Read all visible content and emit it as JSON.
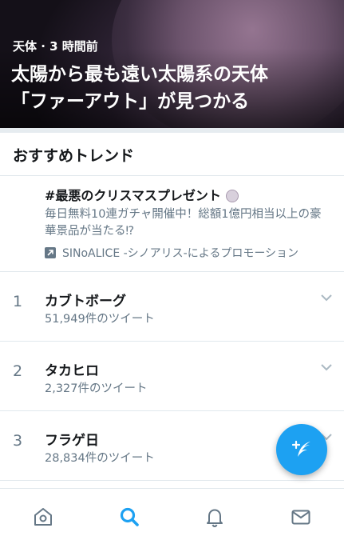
{
  "hero": {
    "meta": "天体 · 3 時間前",
    "title_lines": [
      "太陽から最も遠い太陽系の天体",
      "「ファーアウト」が見つかる"
    ]
  },
  "trends_section": {
    "header": "おすすめトレンド",
    "promoted": {
      "title": "#最悪のクリスマスプレゼント",
      "description": "毎日無料10連ガチャ開催中！総額1億円相当以上の豪華景品が当たる⁉",
      "promoted_by": "SINoALICE -シノアリス-によるプロモーション",
      "promoted_icon": "promoted-arrow-icon"
    },
    "items": [
      {
        "rank": "1",
        "name": "カブトボーグ",
        "count": "51,949件のツイート"
      },
      {
        "rank": "2",
        "name": "タカヒロ",
        "count": "2,327件のツイート"
      },
      {
        "rank": "3",
        "name": "フラゲ日",
        "count": "28,834件のツイート"
      }
    ]
  },
  "fab": {
    "icon": "compose-tweet-icon"
  },
  "nav": {
    "items": [
      {
        "name": "home",
        "icon": "home-icon",
        "active": false
      },
      {
        "name": "explore",
        "icon": "search-icon",
        "active": true
      },
      {
        "name": "notifications",
        "icon": "bell-icon",
        "active": false
      },
      {
        "name": "messages",
        "icon": "envelope-icon",
        "active": false
      }
    ]
  },
  "colors": {
    "accent": "#1da1f2",
    "secondary_text": "#657786",
    "divider": "#e1e8ed"
  }
}
